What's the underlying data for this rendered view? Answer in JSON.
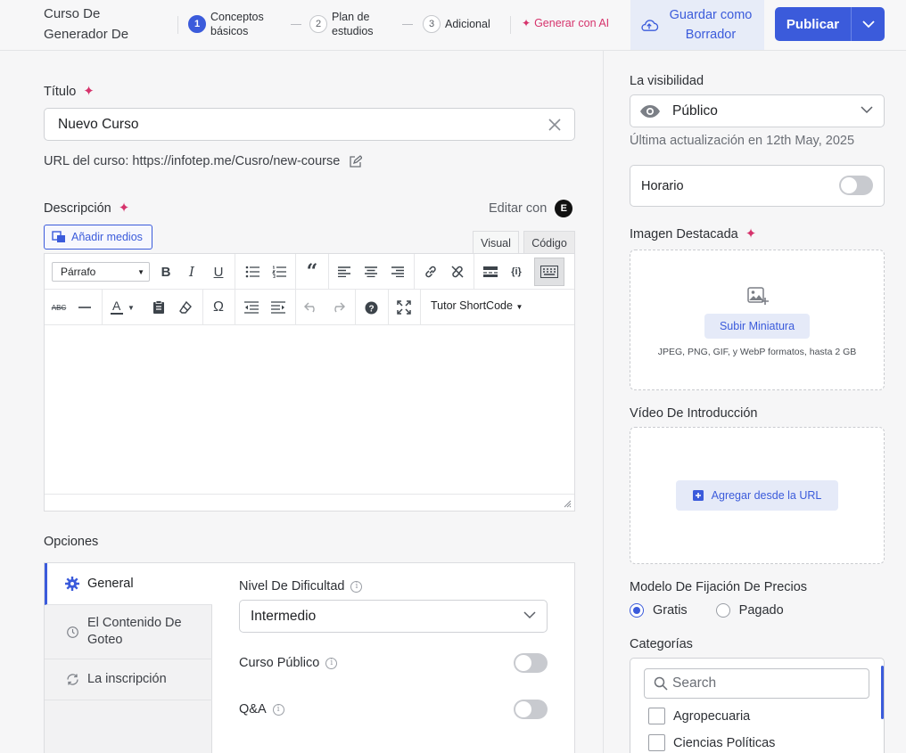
{
  "header": {
    "course_title": "Curso De Generador De",
    "steps": [
      {
        "num": "1",
        "label": "Conceptos básicos"
      },
      {
        "num": "2",
        "label": "Plan de estudios"
      },
      {
        "num": "3",
        "label": "Adicional"
      }
    ],
    "generate_ai": "Generar con AI",
    "save_draft": "Guardar como Borrador",
    "publish": "Publicar"
  },
  "main": {
    "title_label": "Título",
    "title_value": "Nuevo Curso",
    "url_label": "URL del curso:",
    "url_value": "https://infotep.me/Cusro/new-course",
    "description_label": "Descripción",
    "edit_with": "Editar con",
    "elementor_glyph": "E",
    "add_media": "Añadir medios",
    "tab_visual": "Visual",
    "tab_code": "Código",
    "paragraph_format": "Párrafo",
    "shortcode": "Tutor ShortCode",
    "omega": "Ω"
  },
  "options": {
    "heading": "Opciones",
    "nav": [
      "General",
      "El Contenido De Goteo",
      "La inscripción"
    ],
    "difficulty_label": "Nivel De Dificultad",
    "difficulty_value": "Intermedio",
    "public_course_label": "Curso Público",
    "qa_label": "Q&A",
    "public_course_on": false,
    "qa_on": false
  },
  "sidebar": {
    "visibility_label": "La visibilidad",
    "visibility_value": "Público",
    "last_update": "Última actualización en 12th May, 2025",
    "schedule_label": "Horario",
    "schedule_on": false,
    "featured_image_label": "Imagen Destacada",
    "upload_thumbnail": "Subir Miniatura",
    "formats": "JPEG, PNG, GIF, y WebP formatos, hasta 2 GB",
    "intro_video_label": "Vídeo De Introducción",
    "add_from_url": "Agregar desde la URL",
    "pricing_label": "Modelo De Fijación De Precios",
    "pricing_options": [
      "Gratis",
      "Pagado"
    ],
    "pricing_selected": "Gratis",
    "categories_label": "Categorías",
    "categories_search_placeholder": "Search",
    "categories": [
      "Agropecuaria",
      "Ciencias Políticas"
    ]
  },
  "colors": {
    "accent": "#3b5bdb",
    "ai_pink": "#d6336c"
  }
}
